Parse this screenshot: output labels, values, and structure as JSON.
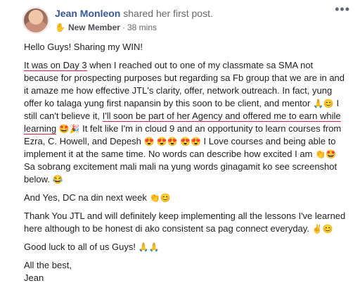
{
  "post": {
    "author": "Jean Monleon",
    "action": "shared her first post.",
    "badge_icon": "✋",
    "badge": "New Member",
    "separator": "·",
    "time": "38 mins",
    "more": "•••"
  },
  "body": {
    "p1": "Hello Guys! Sharing my WIN!",
    "p2a_underlined": "It was on Day 3",
    "p2b": " when I reached out to one of my classmate sa SMA not because for prospecting purposes but regarding sa Fb group that we are in and it amaze me how effective JTL's clarity, offer, network outreach. In fact, yung offer ko talaga yung first napansin by this soon to be client, and mentor ",
    "p2c_emoji": "🙏😊",
    "p2d": " I still can't believe it, ",
    "p2e_underlined": "I'll soon be part of her Agency and offered me to earn while learning",
    "p2f_emoji": " 🤩🎉",
    "p2g": " It felt like I'm in cloud 9 and an opportunity to learn courses from Ezra, C. Howell, and Depesh ",
    "p2h_emoji": "😍 😍😍 😍😍",
    "p2i": " I Love courses and being able to implement it at the same time. No words can describe how excited I am ",
    "p2j_emoji": "👏🤩",
    "p2k": " Sa sobrang excitement mali mali na yung words ginagamit ko see screenshot below. ",
    "p2l_emoji": "😂",
    "p3": "And Yes, DC na din next week ",
    "p3_emoji": "👏😊",
    "p4": "Thank You JTL and will definitely keep implementing all the lessons I've learned here although to be honest di ako consistent sa pag connect everyday. ",
    "p4_emoji": "✌️😊",
    "p5": "Good luck to all of us Guys! ",
    "p5_emoji": "🙏🙏",
    "p6_line1": "All the best,",
    "p6_line2": "Jean"
  }
}
